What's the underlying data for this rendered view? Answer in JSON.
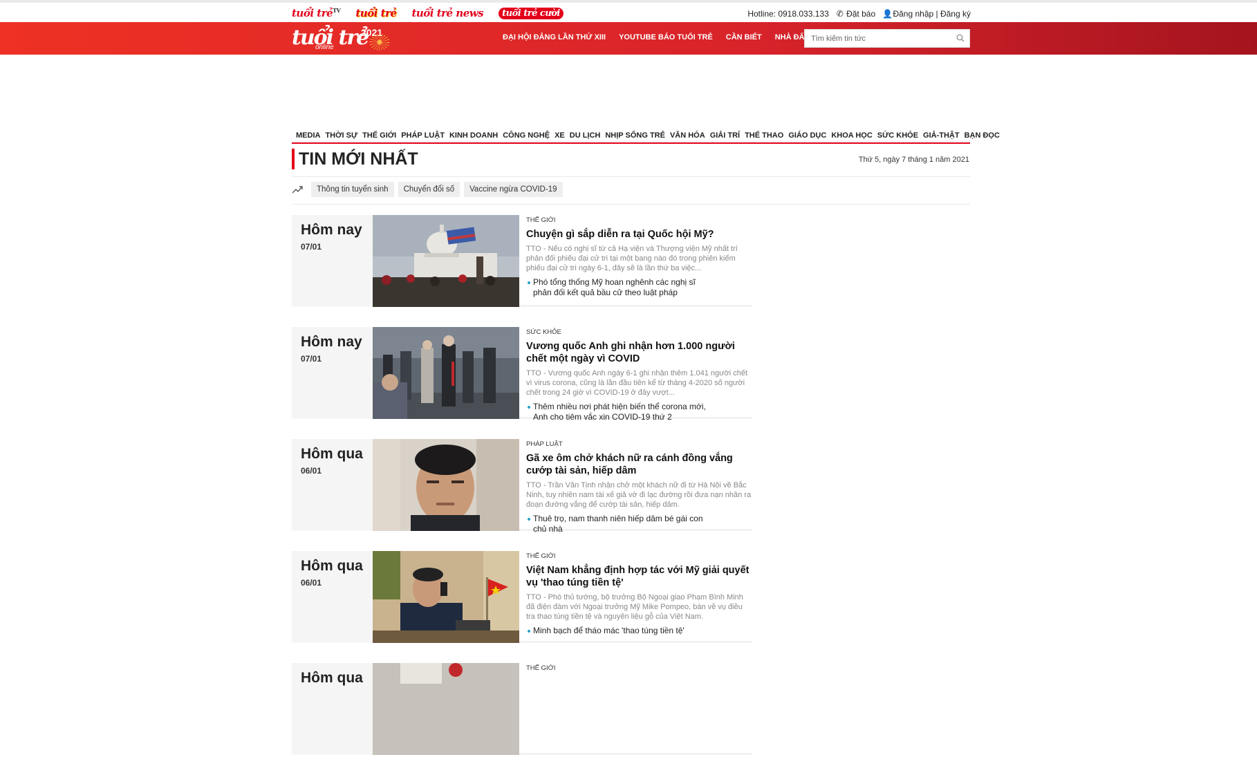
{
  "topbar": {
    "brands": [
      {
        "label": "tuổi trẻ",
        "sup": "TV"
      },
      {
        "label": "tuổi trẻ",
        "sup": ""
      },
      {
        "label": "tuổi trẻ news",
        "sup": ""
      },
      {
        "label": "tuổi trẻ cười",
        "sup": ""
      }
    ],
    "hotline": "Hotline: 0918.033.133",
    "subscribe": "Đặt báo",
    "login": "Đăng nhập | Đăng ký"
  },
  "header": {
    "logo_text": "tuổi trẻ",
    "logo_sub": "online",
    "logo_year": "2021",
    "nav": [
      "ĐẠI HỘI ĐẢNG LẦN THỨ XIII",
      "YOUTUBE BÁO TUỔI TRẺ",
      "CẦN BIẾT",
      "NHÀ ĐẤT"
    ],
    "search_placeholder": "Tìm kiếm tin tức"
  },
  "categories": [
    "MEDIA",
    "THỜI SỰ",
    "THẾ GIỚI",
    "PHÁP LUẬT",
    "KINH DOANH",
    "CÔNG NGHỆ",
    "XE",
    "DU LỊCH",
    "NHỊP SỐNG TRẺ",
    "VĂN HÓA",
    "GIẢI TRÍ",
    "THỂ THAO",
    "GIÁO DỤC",
    "KHOA HỌC",
    "SỨC KHỎE",
    "GIẢ-THẬT",
    "BẠN ĐỌC"
  ],
  "section": {
    "title": "TIN MỚI NHẤT",
    "date": "Thứ 5, ngày 7 tháng 1 năm 2021"
  },
  "tags": [
    "Thông tin tuyển sinh",
    "Chuyển đổi số",
    "Vaccine ngừa COVID-19"
  ],
  "articles": [
    {
      "day": "Hôm nay",
      "date": "07/01",
      "category": "THẾ GIỚI",
      "title": "Chuyện gì sắp diễn ra tại Quốc hội Mỹ?",
      "sapo": "TTO - Nếu có nghị sĩ từ cả Hạ viện và Thượng viện Mỹ nhất trí phản đối phiếu đại cử tri tại một bang nào đó trong phiên kiểm phiếu đại cử tri ngày 6-1, đây sẽ là lần thứ ba việc...",
      "related": "Phó tổng thống Mỹ hoan nghênh các nghị sĩ phản đối kết quả bầu cử theo luật pháp",
      "image": "capitol"
    },
    {
      "day": "Hôm nay",
      "date": "07/01",
      "category": "SỨC KHỎE",
      "title": "Vương quốc Anh ghi nhận hơn 1.000 người chết một ngày vì COVID",
      "sapo": "TTO - Vương quốc Anh ngày 6-1 ghi nhận thêm 1.041 người chết vì virus corona, cũng là lần đầu tiên kể từ tháng 4-2020 số người chết trong 24 giờ vì COVID-19 ở đây vượt...",
      "related": "Thêm nhiều nơi phát hiện biến thể corona mới, Anh cho tiêm vắc xin COVID-19 thứ 2",
      "image": "street"
    },
    {
      "day": "Hôm qua",
      "date": "06/01",
      "category": "PHÁP LUẬT",
      "title": "Gã xe ôm chở khách nữ ra cánh đồng vắng cướp tài sản, hiếp dâm",
      "sapo": "TTO - Trần Văn Tịnh nhận chở một khách nữ đi từ Hà Nội về Bắc Ninh, tuy nhiên nam tài xế giả vờ đi lạc đường rồi đưa nạn nhân ra đoạn đường vắng để cướp tài sản, hiếp dâm.",
      "related": "Thuê trọ, nam thanh niên hiếp dâm bé gái con chủ nhà",
      "image": "portrait"
    },
    {
      "day": "Hôm qua",
      "date": "06/01",
      "category": "THẾ GIỚI",
      "title": "Việt Nam khẳng định hợp tác với Mỹ giải quyết vụ 'thao túng tiền tệ'",
      "sapo": "TTO - Phó thủ tướng, bộ trưởng Bộ Ngoại giao Phạm Bình Minh đã điện đàm với Ngoại trưởng Mỹ Mike Pompeo, bàn về vụ điều tra thao túng tiền tệ và nguyên liệu gỗ của Việt Nam.",
      "related": "Minh bạch để tháo mác 'thao túng tiền tệ'",
      "image": "phone"
    },
    {
      "day": "Hôm qua",
      "date": "",
      "category": "THẾ GIỚI",
      "title": "",
      "sapo": "",
      "related": "",
      "image": "partial"
    }
  ]
}
